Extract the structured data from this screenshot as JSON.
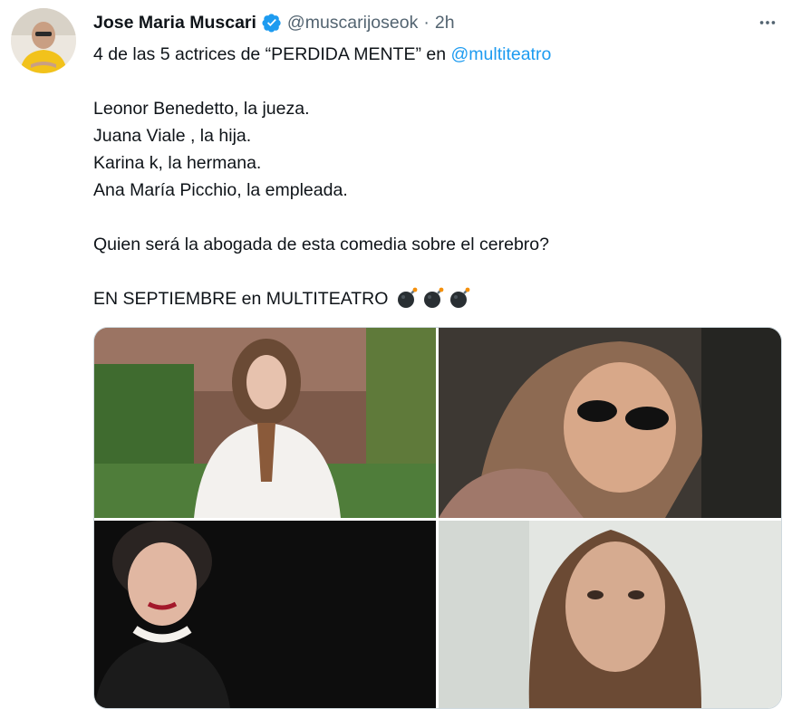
{
  "author": {
    "name": "Jose Maria Muscari",
    "handle": "@muscarijoseok",
    "separator": "·",
    "time": "2h"
  },
  "tweet": {
    "line1_pre": "4 de las 5 actrices de “PERDIDA MENTE” en ",
    "line1_mention": "@multiteatro",
    "line2": "Leonor Benedetto, la jueza.",
    "line3": "Juana Viale , la hija.",
    "line4": "Karina k, la hermana.",
    "line5": "Ana María Picchio, la empleada.",
    "line6": "Quien será la abogada de esta comedia sobre el cerebro?",
    "line7": "EN SEPTIEMBRE en MULTITEATRO"
  },
  "icons": {
    "verified": "verified-badge-icon",
    "more": "more-options-icon",
    "bomb": "bomb-emoji"
  },
  "colors": {
    "accent": "#1d9bf0",
    "secondary_text": "#536471",
    "border": "#cfd9de"
  },
  "media": {
    "photos": [
      "photo-1",
      "photo-2",
      "photo-3",
      "photo-4"
    ]
  }
}
